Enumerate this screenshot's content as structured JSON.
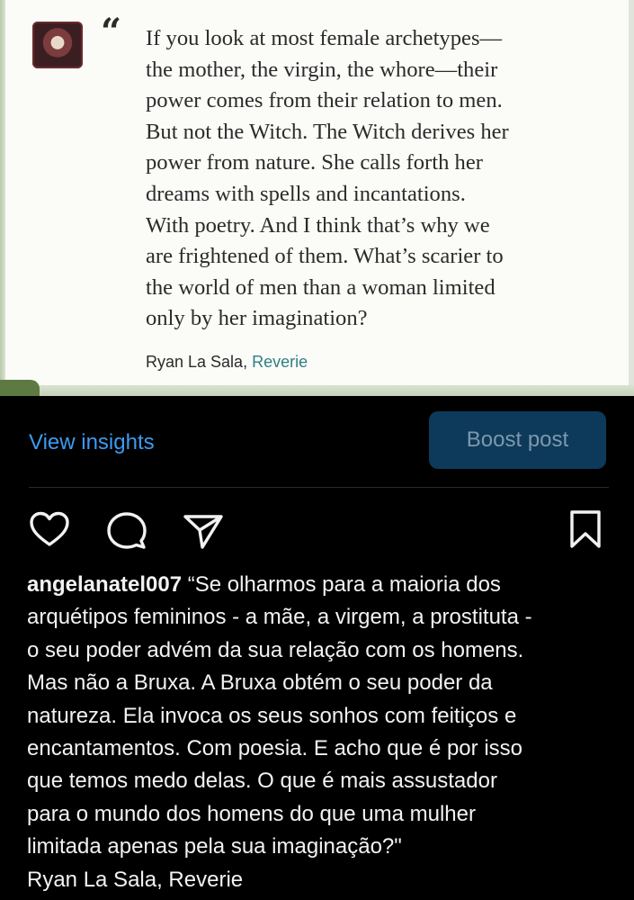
{
  "post": {
    "quote_lines": [
      "If you look at most female archetypes—",
      "the mother, the virgin, the whore—their",
      "power comes from their relation to men.",
      "But not the Witch. The Witch derives her",
      "power from nature. She calls forth her",
      "dreams with spells and incantations.",
      "With poetry. And I think that’s why we",
      "are frightened of them. What’s scarier to",
      "the world of men than a woman limited",
      "only by her imagination?"
    ],
    "quote_mark": "“",
    "author": "Ryan La Sala,",
    "book": "Reverie"
  },
  "insights": {
    "view_label": "View insights",
    "boost_label": "Boost post",
    "boost_bg": "#0d3a5a",
    "link_color": "#3d9bf0"
  },
  "actions": {
    "like": "heart-icon",
    "comment": "comment-bubble-icon",
    "share": "paper-plane-icon",
    "save": "bookmark-icon"
  },
  "caption": {
    "username": "angelanatel007",
    "first_line_rest": " “Se olharmos para a maioria dos",
    "lines": [
      "arquétipos femininos - a mãe, a virgem, a prostituta -",
      "o seu poder advém da sua relação com os homens.",
      "Mas não a Bruxa. A Bruxa obtém o seu poder da",
      "natureza. Ela invoca os seus sonhos com feitiços e",
      "encantamentos. Com poesia. E acho que é por isso",
      "que temos medo delas. O que é mais assustador",
      "para o mundo dos homens do que uma mulher",
      "limitada apenas pela sua imaginação?\"",
      "Ryan La Sala, Reverie"
    ]
  }
}
